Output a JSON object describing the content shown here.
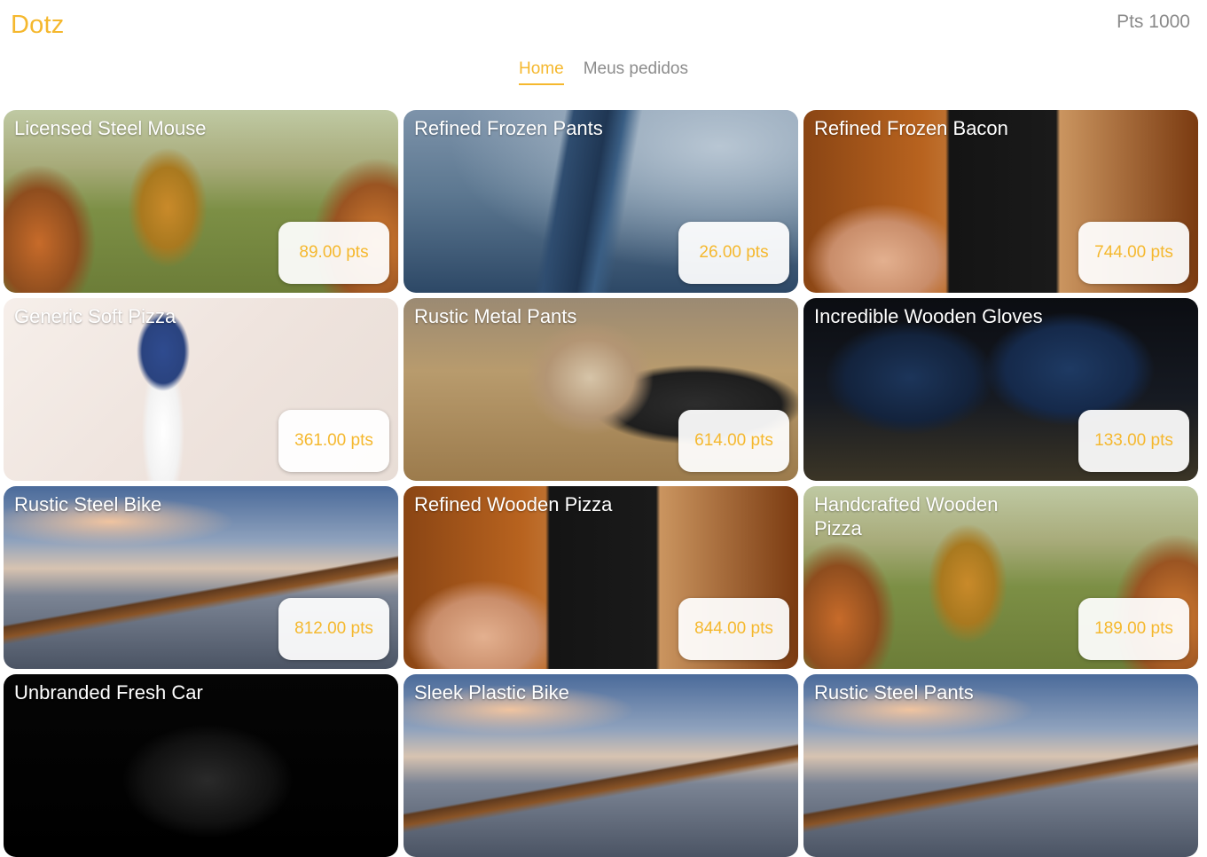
{
  "app": {
    "logo": "Dotz",
    "points": "Pts 1000"
  },
  "nav": {
    "tabs": [
      {
        "label": "Home",
        "active": true
      },
      {
        "label": "Meus pedidos",
        "active": false
      }
    ]
  },
  "colors": {
    "accent": "#f5b82e",
    "muted_text": "#8a8a8a"
  },
  "products": [
    {
      "title": "Licensed Steel Mouse",
      "price": "89.00 pts"
    },
    {
      "title": "Refined Frozen Pants",
      "price": "26.00 pts"
    },
    {
      "title": "Refined Frozen Bacon",
      "price": "744.00 pts"
    },
    {
      "title": "Generic Soft Pizza",
      "price": "361.00 pts"
    },
    {
      "title": "Rustic Metal Pants",
      "price": "614.00 pts"
    },
    {
      "title": "Incredible Wooden Gloves",
      "price": "133.00 pts"
    },
    {
      "title": "Rustic Steel Bike",
      "price": "812.00 pts"
    },
    {
      "title": "Refined Wooden Pizza",
      "price": "844.00 pts"
    },
    {
      "title": "Handcrafted Wooden Pizza",
      "price": "189.00 pts"
    },
    {
      "title": "Unbranded Fresh Car",
      "price": ""
    },
    {
      "title": "Sleek Plastic Bike",
      "price": ""
    },
    {
      "title": "Rustic Steel Pants",
      "price": ""
    }
  ]
}
